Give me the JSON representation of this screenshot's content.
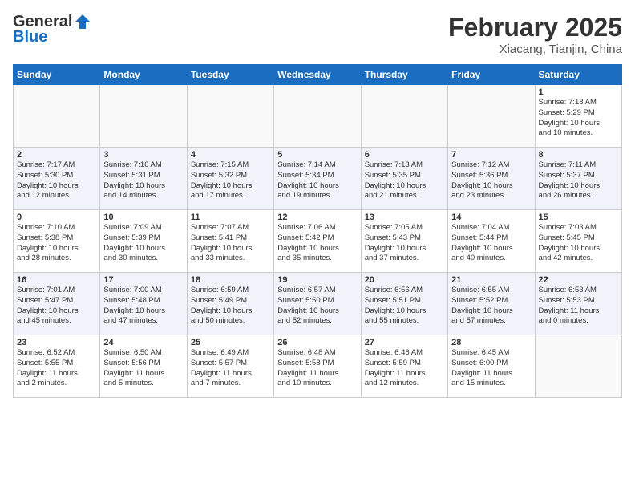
{
  "logo": {
    "line1": "General",
    "line2": "Blue"
  },
  "title": "February 2025",
  "location": "Xiacang, Tianjin, China",
  "days_of_week": [
    "Sunday",
    "Monday",
    "Tuesday",
    "Wednesday",
    "Thursday",
    "Friday",
    "Saturday"
  ],
  "weeks": [
    [
      {
        "day": "",
        "info": ""
      },
      {
        "day": "",
        "info": ""
      },
      {
        "day": "",
        "info": ""
      },
      {
        "day": "",
        "info": ""
      },
      {
        "day": "",
        "info": ""
      },
      {
        "day": "",
        "info": ""
      },
      {
        "day": "1",
        "info": "Sunrise: 7:18 AM\nSunset: 5:29 PM\nDaylight: 10 hours\nand 10 minutes."
      }
    ],
    [
      {
        "day": "2",
        "info": "Sunrise: 7:17 AM\nSunset: 5:30 PM\nDaylight: 10 hours\nand 12 minutes."
      },
      {
        "day": "3",
        "info": "Sunrise: 7:16 AM\nSunset: 5:31 PM\nDaylight: 10 hours\nand 14 minutes."
      },
      {
        "day": "4",
        "info": "Sunrise: 7:15 AM\nSunset: 5:32 PM\nDaylight: 10 hours\nand 17 minutes."
      },
      {
        "day": "5",
        "info": "Sunrise: 7:14 AM\nSunset: 5:34 PM\nDaylight: 10 hours\nand 19 minutes."
      },
      {
        "day": "6",
        "info": "Sunrise: 7:13 AM\nSunset: 5:35 PM\nDaylight: 10 hours\nand 21 minutes."
      },
      {
        "day": "7",
        "info": "Sunrise: 7:12 AM\nSunset: 5:36 PM\nDaylight: 10 hours\nand 23 minutes."
      },
      {
        "day": "8",
        "info": "Sunrise: 7:11 AM\nSunset: 5:37 PM\nDaylight: 10 hours\nand 26 minutes."
      }
    ],
    [
      {
        "day": "9",
        "info": "Sunrise: 7:10 AM\nSunset: 5:38 PM\nDaylight: 10 hours\nand 28 minutes."
      },
      {
        "day": "10",
        "info": "Sunrise: 7:09 AM\nSunset: 5:39 PM\nDaylight: 10 hours\nand 30 minutes."
      },
      {
        "day": "11",
        "info": "Sunrise: 7:07 AM\nSunset: 5:41 PM\nDaylight: 10 hours\nand 33 minutes."
      },
      {
        "day": "12",
        "info": "Sunrise: 7:06 AM\nSunset: 5:42 PM\nDaylight: 10 hours\nand 35 minutes."
      },
      {
        "day": "13",
        "info": "Sunrise: 7:05 AM\nSunset: 5:43 PM\nDaylight: 10 hours\nand 37 minutes."
      },
      {
        "day": "14",
        "info": "Sunrise: 7:04 AM\nSunset: 5:44 PM\nDaylight: 10 hours\nand 40 minutes."
      },
      {
        "day": "15",
        "info": "Sunrise: 7:03 AM\nSunset: 5:45 PM\nDaylight: 10 hours\nand 42 minutes."
      }
    ],
    [
      {
        "day": "16",
        "info": "Sunrise: 7:01 AM\nSunset: 5:47 PM\nDaylight: 10 hours\nand 45 minutes."
      },
      {
        "day": "17",
        "info": "Sunrise: 7:00 AM\nSunset: 5:48 PM\nDaylight: 10 hours\nand 47 minutes."
      },
      {
        "day": "18",
        "info": "Sunrise: 6:59 AM\nSunset: 5:49 PM\nDaylight: 10 hours\nand 50 minutes."
      },
      {
        "day": "19",
        "info": "Sunrise: 6:57 AM\nSunset: 5:50 PM\nDaylight: 10 hours\nand 52 minutes."
      },
      {
        "day": "20",
        "info": "Sunrise: 6:56 AM\nSunset: 5:51 PM\nDaylight: 10 hours\nand 55 minutes."
      },
      {
        "day": "21",
        "info": "Sunrise: 6:55 AM\nSunset: 5:52 PM\nDaylight: 10 hours\nand 57 minutes."
      },
      {
        "day": "22",
        "info": "Sunrise: 6:53 AM\nSunset: 5:53 PM\nDaylight: 11 hours\nand 0 minutes."
      }
    ],
    [
      {
        "day": "23",
        "info": "Sunrise: 6:52 AM\nSunset: 5:55 PM\nDaylight: 11 hours\nand 2 minutes."
      },
      {
        "day": "24",
        "info": "Sunrise: 6:50 AM\nSunset: 5:56 PM\nDaylight: 11 hours\nand 5 minutes."
      },
      {
        "day": "25",
        "info": "Sunrise: 6:49 AM\nSunset: 5:57 PM\nDaylight: 11 hours\nand 7 minutes."
      },
      {
        "day": "26",
        "info": "Sunrise: 6:48 AM\nSunset: 5:58 PM\nDaylight: 11 hours\nand 10 minutes."
      },
      {
        "day": "27",
        "info": "Sunrise: 6:46 AM\nSunset: 5:59 PM\nDaylight: 11 hours\nand 12 minutes."
      },
      {
        "day": "28",
        "info": "Sunrise: 6:45 AM\nSunset: 6:00 PM\nDaylight: 11 hours\nand 15 minutes."
      },
      {
        "day": "",
        "info": ""
      }
    ]
  ]
}
